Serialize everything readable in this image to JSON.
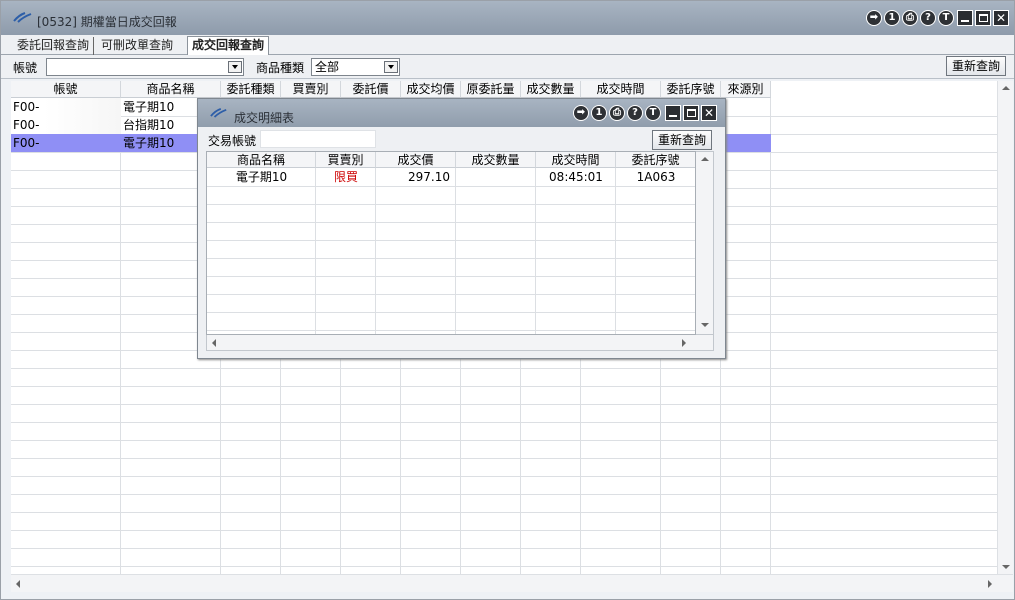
{
  "window": {
    "title": "[0532] 期權當日成交回報"
  },
  "tabs": [
    {
      "label": "委託回報查詢"
    },
    {
      "label": "可刪改單查詢"
    },
    {
      "label": "成交回報查詢",
      "active": true
    }
  ],
  "filters": {
    "account_label": "帳號",
    "account_value": "",
    "product_type_label": "商品種類",
    "product_type_value": "全部",
    "requery_label": "重新查詢"
  },
  "grid": {
    "columns": [
      "帳號",
      "商品名稱",
      "委託種類",
      "買賣別",
      "委託價",
      "成交均價",
      "原委託量",
      "成交數量",
      "成交時間",
      "委託序號",
      "來源別"
    ],
    "rows": [
      {
        "account": "F00-",
        "product": "電子期10"
      },
      {
        "account": "F00-",
        "product": "台指期10"
      },
      {
        "account": "F00-",
        "product": "電子期10",
        "selected": true
      }
    ]
  },
  "popup": {
    "title": "成交明細表",
    "account_label": "交易帳號",
    "account_value": "",
    "requery_label": "重新查詢",
    "columns": [
      "商品名稱",
      "買賣別",
      "成交價",
      "成交數量",
      "成交時間",
      "委託序號"
    ],
    "rows": [
      {
        "product": "電子期10",
        "side": "限買",
        "price": "297.10",
        "qty": "",
        "time": "08:45:01",
        "order_no": "1A063"
      }
    ]
  },
  "toolbar_icons": [
    "export-icon",
    "info-1-icon",
    "print-icon",
    "help-icon",
    "topmost-icon"
  ],
  "toolbar_glyphs": [
    "➡",
    "1",
    "⎙",
    "?",
    "T"
  ],
  "colors": {
    "selected_row": "#8f8ff5",
    "sell_text": "#cc0000",
    "titlebar": "#9aa7b6"
  }
}
